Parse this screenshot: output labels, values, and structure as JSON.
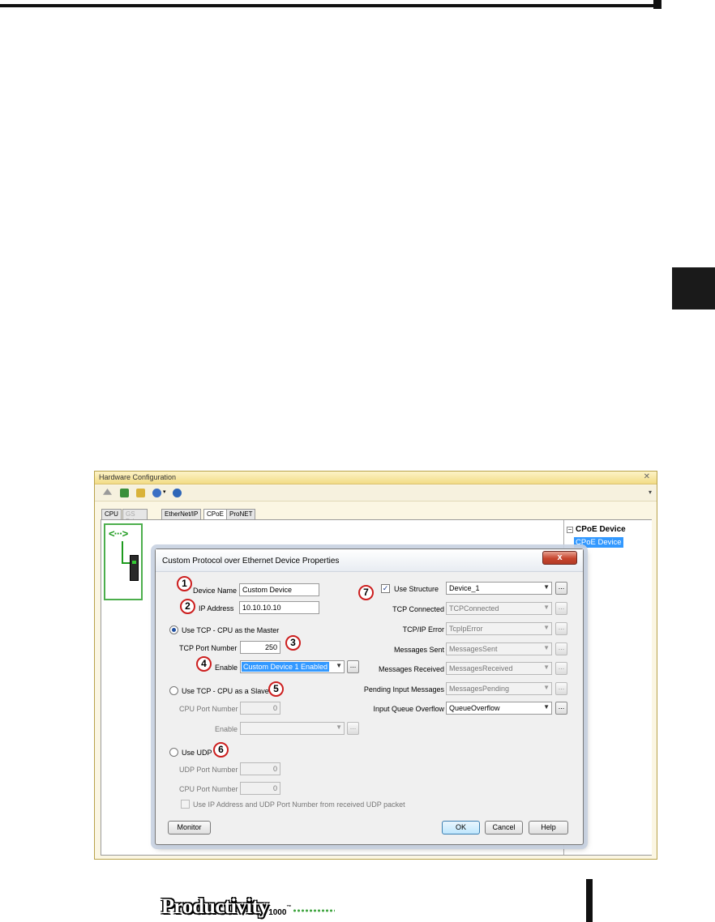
{
  "page": {
    "logo_word": "Productivity",
    "logo_number": "1000",
    "logo_tm": "™"
  },
  "hw_window": {
    "title": "Hardware Configuration",
    "close": "✕",
    "toolbar": {
      "icons": [
        "eject-icon",
        "verify-icon",
        "refresh-icon",
        "discover-icon",
        "help-icon"
      ],
      "dropdown_glyph": "▾"
    },
    "tabs": [
      "CPU",
      "GS Drives",
      "EtherNet/IP",
      "CPoE",
      "ProNET"
    ],
    "device_icon_glyph": "<···>",
    "tree": {
      "header": "CPoE Device",
      "expander": "−",
      "item": "CPoE Device"
    }
  },
  "dialog": {
    "title": "Custom Protocol over Ethernet Device Properties",
    "close": "x",
    "device_name_label": "Device Name",
    "device_name_value": "Custom Device",
    "ip_address_label": "IP Address",
    "ip_address_value": "10.10.10.10",
    "master_radio_label": "Use TCP - CPU as the Master",
    "tcp_port_label": "TCP Port Number",
    "tcp_port_value": "250",
    "enable_label": "Enable",
    "enable_value": "Custom Device 1 Enabled",
    "slave_radio_label": "Use TCP - CPU as a Slave",
    "cpu_port_label": "CPU Port Number",
    "cpu_port_value": "0",
    "slave_enable_label": "Enable",
    "slave_enable_value": "",
    "udp_radio_label": "Use UDP",
    "udp_port_label": "UDP Port Number",
    "udp_port_value": "0",
    "udp_cpu_port_label": "CPU Port Number",
    "udp_cpu_port_value": "0",
    "udp_packet_label": "Use IP Address and UDP Port Number from received UDP packet",
    "use_structure_label": "Use Structure",
    "use_structure_value": "Device_1",
    "tcp_connected_label": "TCP Connected",
    "tcp_connected_value": "TCPConnected",
    "tcpip_error_label": "TCP/IP Error",
    "tcpip_error_value": "TcpIpError",
    "messages_sent_label": "Messages Sent",
    "messages_sent_value": "MessagesSent",
    "messages_received_label": "Messages Received",
    "messages_received_value": "MessagesReceived",
    "pending_label": "Pending Input Messages",
    "pending_value": "MessagesPending",
    "overflow_label": "Input Queue Overflow",
    "overflow_value": "QueueOverflow",
    "ellipsis": "...",
    "arrow": "▼",
    "check_glyph": "✓",
    "buttons": {
      "monitor": "Monitor",
      "ok": "OK",
      "cancel": "Cancel",
      "help": "Help"
    },
    "callouts": [
      "1",
      "2",
      "3",
      "4",
      "5",
      "6",
      "7"
    ]
  }
}
